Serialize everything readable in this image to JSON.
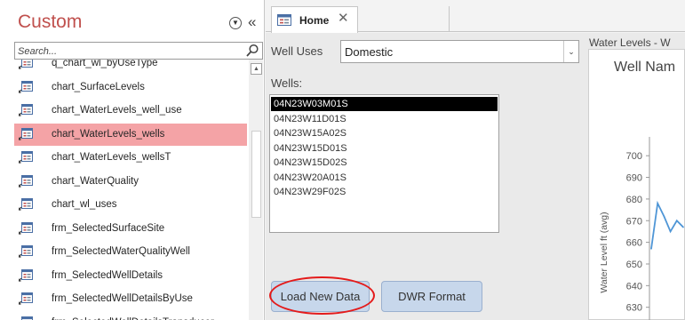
{
  "nav": {
    "title": "Custom",
    "search_placeholder": "Search...",
    "items": [
      {
        "label": "q_chart_wl_byUseType"
      },
      {
        "label": "chart_SurfaceLevels"
      },
      {
        "label": "chart_WaterLevels_well_use"
      },
      {
        "label": "chart_WaterLevels_wells",
        "selected": true
      },
      {
        "label": "chart_WaterLevels_wellsT"
      },
      {
        "label": "chart_WaterQuality"
      },
      {
        "label": "chart_wl_uses"
      },
      {
        "label": "frm_SelectedSurfaceSite"
      },
      {
        "label": "frm_SelectedWaterQualityWell"
      },
      {
        "label": "frm_SelectedWellDetails"
      },
      {
        "label": "frm_SelectedWellDetailsByUse"
      },
      {
        "label": "frm_SelectedWellDetailsTransducer"
      }
    ]
  },
  "tab": {
    "label": "Home"
  },
  "form": {
    "well_uses_label": "Well Uses",
    "well_uses_value": "Domestic",
    "wells_label": "Wells:",
    "wells": [
      "04N23W03M01S",
      "04N23W11D01S",
      "04N23W15A02S",
      "04N23W15D01S",
      "04N23W15D02S",
      "04N23W20A01S",
      "04N23W29F02S"
    ],
    "selected_well_index": 0,
    "load_button": "Load New Data",
    "dwr_button": "DWR Format"
  },
  "chart": {
    "caption": "Water Levels - W",
    "title": "Well Nam",
    "ylabel": "Water Level ft (avg)",
    "line_color": "#4f96d6"
  },
  "chart_data": {
    "type": "line",
    "title": "Well Nam",
    "ylabel": "Water Level ft (avg)",
    "yticks": [
      630,
      640,
      650,
      660,
      670,
      680,
      690,
      700
    ],
    "ylim": [
      627,
      705
    ],
    "series": [
      {
        "values": [
          657,
          678,
          672,
          665,
          670,
          667
        ]
      }
    ]
  },
  "colors": {
    "accent": "#c0504d",
    "selected_row": "#f4a3a6",
    "button": "#c7d7eb",
    "highlight_circle": "#e41b1b"
  }
}
